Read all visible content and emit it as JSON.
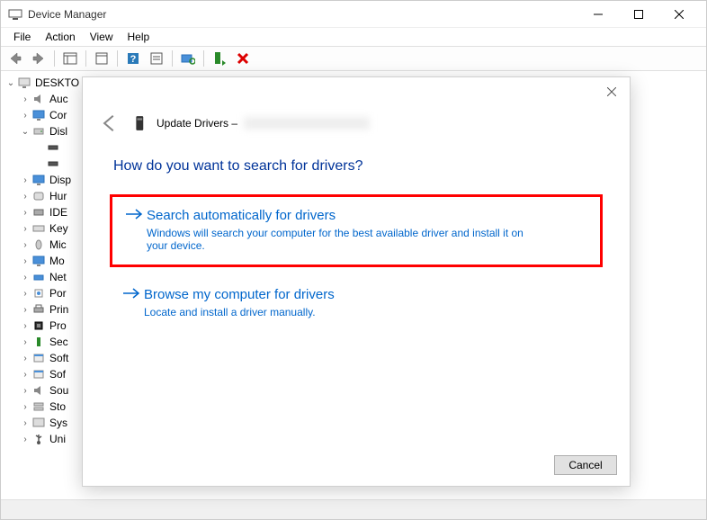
{
  "window": {
    "title": "Device Manager"
  },
  "menu": {
    "file": "File",
    "action": "Action",
    "view": "View",
    "help": "Help"
  },
  "tree": {
    "root": "DESKTO",
    "items": [
      {
        "label": "Auc",
        "expanded": false,
        "indent": 1,
        "icon": "audio"
      },
      {
        "label": "Cor",
        "expanded": false,
        "indent": 1,
        "icon": "monitor"
      },
      {
        "label": "Disl",
        "expanded": true,
        "indent": 1,
        "icon": "disk"
      },
      {
        "label": "",
        "expanded": null,
        "indent": 2,
        "icon": "drive"
      },
      {
        "label": "",
        "expanded": null,
        "indent": 2,
        "icon": "drive"
      },
      {
        "label": "Disp",
        "expanded": false,
        "indent": 1,
        "icon": "monitor"
      },
      {
        "label": "Hur",
        "expanded": false,
        "indent": 1,
        "icon": "hid"
      },
      {
        "label": "IDE",
        "expanded": false,
        "indent": 1,
        "icon": "ide"
      },
      {
        "label": "Key",
        "expanded": false,
        "indent": 1,
        "icon": "keyboard"
      },
      {
        "label": "Mic",
        "expanded": false,
        "indent": 1,
        "icon": "mouse"
      },
      {
        "label": "Mo",
        "expanded": false,
        "indent": 1,
        "icon": "monitor"
      },
      {
        "label": "Net",
        "expanded": false,
        "indent": 1,
        "icon": "network"
      },
      {
        "label": "Por",
        "expanded": false,
        "indent": 1,
        "icon": "port"
      },
      {
        "label": "Prin",
        "expanded": false,
        "indent": 1,
        "icon": "printer"
      },
      {
        "label": "Pro",
        "expanded": false,
        "indent": 1,
        "icon": "cpu"
      },
      {
        "label": "Sec",
        "expanded": false,
        "indent": 1,
        "icon": "security"
      },
      {
        "label": "Soft",
        "expanded": false,
        "indent": 1,
        "icon": "software"
      },
      {
        "label": "Sof",
        "expanded": false,
        "indent": 1,
        "icon": "software"
      },
      {
        "label": "Sou",
        "expanded": false,
        "indent": 1,
        "icon": "audio"
      },
      {
        "label": "Sto",
        "expanded": false,
        "indent": 1,
        "icon": "storage"
      },
      {
        "label": "Sys",
        "expanded": false,
        "indent": 1,
        "icon": "system"
      },
      {
        "label": "Uni",
        "expanded": false,
        "indent": 1,
        "icon": "usb"
      }
    ]
  },
  "dialog": {
    "header_prefix": "Update Drivers – ",
    "question": "How do you want to search for drivers?",
    "option1": {
      "title": "Search automatically for drivers",
      "desc": "Windows will search your computer for the best available driver and install it on your device."
    },
    "option2": {
      "title": "Browse my computer for drivers",
      "desc": "Locate and install a driver manually."
    },
    "cancel": "Cancel"
  }
}
